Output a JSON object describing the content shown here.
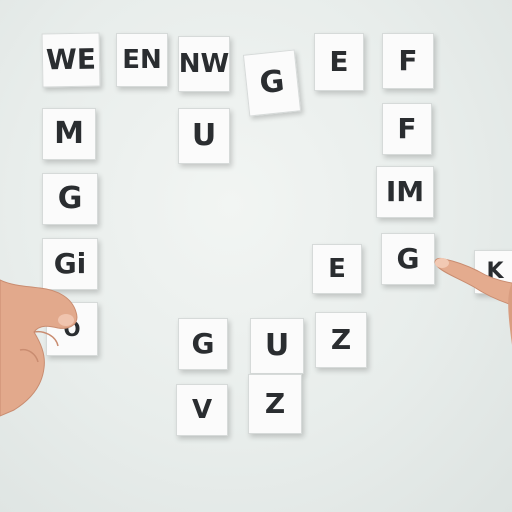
{
  "scene": {
    "background": "#e9eeec",
    "tile_color": "#fbfbfb",
    "letter_color": "#2a2d30",
    "skin_color": "#e2a98c"
  },
  "tiles": [
    {
      "id": "w1",
      "text": "WE"
    },
    {
      "id": "en1",
      "text": "EN"
    },
    {
      "id": "nw1",
      "text": "NW"
    },
    {
      "id": "g1",
      "text": "G"
    },
    {
      "id": "e1",
      "text": "E"
    },
    {
      "id": "f1",
      "text": "F"
    },
    {
      "id": "m1",
      "text": "M"
    },
    {
      "id": "u1",
      "text": "U"
    },
    {
      "id": "f2",
      "text": "F"
    },
    {
      "id": "g2",
      "text": "G"
    },
    {
      "id": "im1",
      "text": "IM"
    },
    {
      "id": "g3",
      "text": "Gi"
    },
    {
      "id": "e2",
      "text": "E"
    },
    {
      "id": "g4",
      "text": "G"
    },
    {
      "id": "k1",
      "text": "K"
    },
    {
      "id": "o1",
      "text": "O"
    },
    {
      "id": "g5",
      "text": "G"
    },
    {
      "id": "u2",
      "text": "U"
    },
    {
      "id": "z1",
      "text": "Z"
    },
    {
      "id": "v1",
      "text": "V"
    },
    {
      "id": "z2",
      "text": "Z"
    }
  ]
}
